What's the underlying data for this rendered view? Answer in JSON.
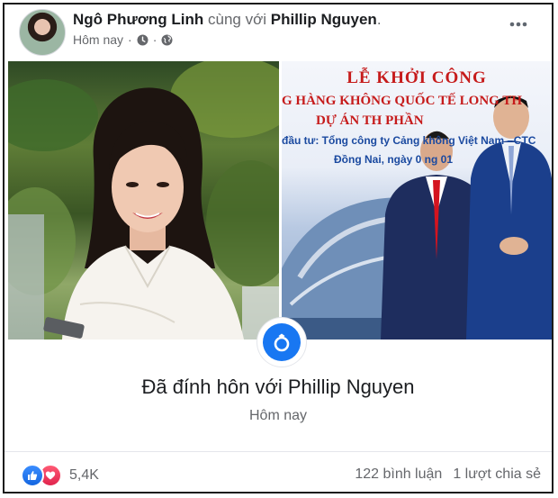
{
  "post": {
    "author": "Ngô Phương Linh",
    "with_word": "cùng với",
    "tagged": "Phillip Nguyen",
    "tag_suffix": ".",
    "time": "Hôm nay",
    "dot": "·"
  },
  "sign": {
    "title": "LỄ KHỞI CÔNG",
    "line2": "G HÀNG KHÔNG QUỐC TẾ LONG TH",
    "line3": "DỰ ÁN TH  PHẦN",
    "line4": "đầu tư: Tổng công ty Cảng   không Việt Nam - CTC",
    "line5": "Đồng Nai, ngày 0   ng 01"
  },
  "event": {
    "title": "Đã đính hôn với Phillip Nguyen",
    "time": "Hôm nay"
  },
  "footer": {
    "reaction_count": "5,4K",
    "comments": "122 bình luận",
    "shares": "1 lượt chia sẻ"
  },
  "icons": {
    "ring": "ring-icon",
    "like": "like-icon",
    "love": "heart-icon",
    "clock": "clock-icon",
    "globe": "globe-icon",
    "more": "more-icon"
  },
  "colors": {
    "accent": "#1877f2",
    "text": "#1c1e21",
    "muted": "#65676b",
    "sign_red": "#c61b1b",
    "sign_blue": "#1b4aa0"
  }
}
